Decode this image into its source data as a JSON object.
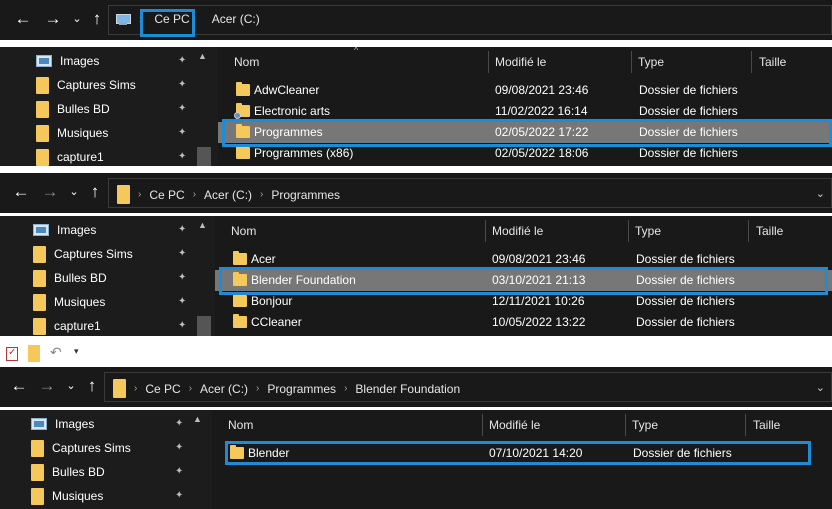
{
  "colors": {
    "highlight": "#1e8bd6",
    "folder": "#f4c85a",
    "selected_row": "#777777"
  },
  "panel1": {
    "crumbs": [
      {
        "label": "Ce PC"
      },
      {
        "label": "Acer (C:)"
      }
    ],
    "sidebar": [
      {
        "label": "Images",
        "icon": "image-icon"
      },
      {
        "label": "Captures Sims",
        "icon": "folder-icon"
      },
      {
        "label": "Bulles BD",
        "icon": "folder-icon"
      },
      {
        "label": "Musiques",
        "icon": "folder-icon"
      },
      {
        "label": "capture1",
        "icon": "folder-icon"
      }
    ],
    "columns": {
      "name": "Nom",
      "modified": "Modifié le",
      "type": "Type",
      "size": "Taille"
    },
    "rows": [
      {
        "name": "AdwCleaner",
        "modified": "09/08/2021 23:46",
        "type": "Dossier de fichiers"
      },
      {
        "name": "Electronic arts",
        "modified": "11/02/2022 16:14",
        "type": "Dossier de fichiers"
      },
      {
        "name": "Programmes",
        "modified": "02/05/2022 17:22",
        "type": "Dossier de fichiers",
        "selected": true
      },
      {
        "name": "Programmes (x86)",
        "modified": "02/05/2022 18:06",
        "type": "Dossier de fichiers"
      }
    ]
  },
  "panel2": {
    "crumbs": [
      {
        "label": "Ce PC"
      },
      {
        "label": "Acer (C:)"
      },
      {
        "label": "Programmes"
      }
    ],
    "sidebar": [
      {
        "label": "Images",
        "icon": "image-icon"
      },
      {
        "label": "Captures Sims",
        "icon": "folder-icon"
      },
      {
        "label": "Bulles BD",
        "icon": "folder-icon"
      },
      {
        "label": "Musiques",
        "icon": "folder-icon"
      },
      {
        "label": "capture1",
        "icon": "folder-icon"
      }
    ],
    "columns": {
      "name": "Nom",
      "modified": "Modifié le",
      "type": "Type",
      "size": "Taille"
    },
    "rows": [
      {
        "name": "Acer",
        "modified": "09/08/2021 23:46",
        "type": "Dossier de fichiers"
      },
      {
        "name": "Blender Foundation",
        "modified": "03/10/2021 21:13",
        "type": "Dossier de fichiers",
        "selected": true
      },
      {
        "name": "Bonjour",
        "modified": "12/11/2021 10:26",
        "type": "Dossier de fichiers"
      },
      {
        "name": "CCleaner",
        "modified": "10/05/2022 13:22",
        "type": "Dossier de fichiers"
      }
    ]
  },
  "panel3": {
    "crumbs": [
      {
        "label": "Ce PC"
      },
      {
        "label": "Acer (C:)"
      },
      {
        "label": "Programmes"
      },
      {
        "label": "Blender Foundation"
      }
    ],
    "sidebar": [
      {
        "label": "Images",
        "icon": "image-icon"
      },
      {
        "label": "Captures Sims",
        "icon": "folder-icon"
      },
      {
        "label": "Bulles BD",
        "icon": "folder-icon"
      },
      {
        "label": "Musiques",
        "icon": "folder-icon"
      }
    ],
    "columns": {
      "name": "Nom",
      "modified": "Modifié le",
      "type": "Type",
      "size": "Taille"
    },
    "rows": [
      {
        "name": "Blender",
        "modified": "07/10/2021 14:20",
        "type": "Dossier de fichiers"
      }
    ]
  },
  "icons": {
    "back": "←",
    "forward": "→",
    "recent": "⌄",
    "up": "↑",
    "sep": "›",
    "pin": "📌",
    "chevron": "⌄"
  }
}
